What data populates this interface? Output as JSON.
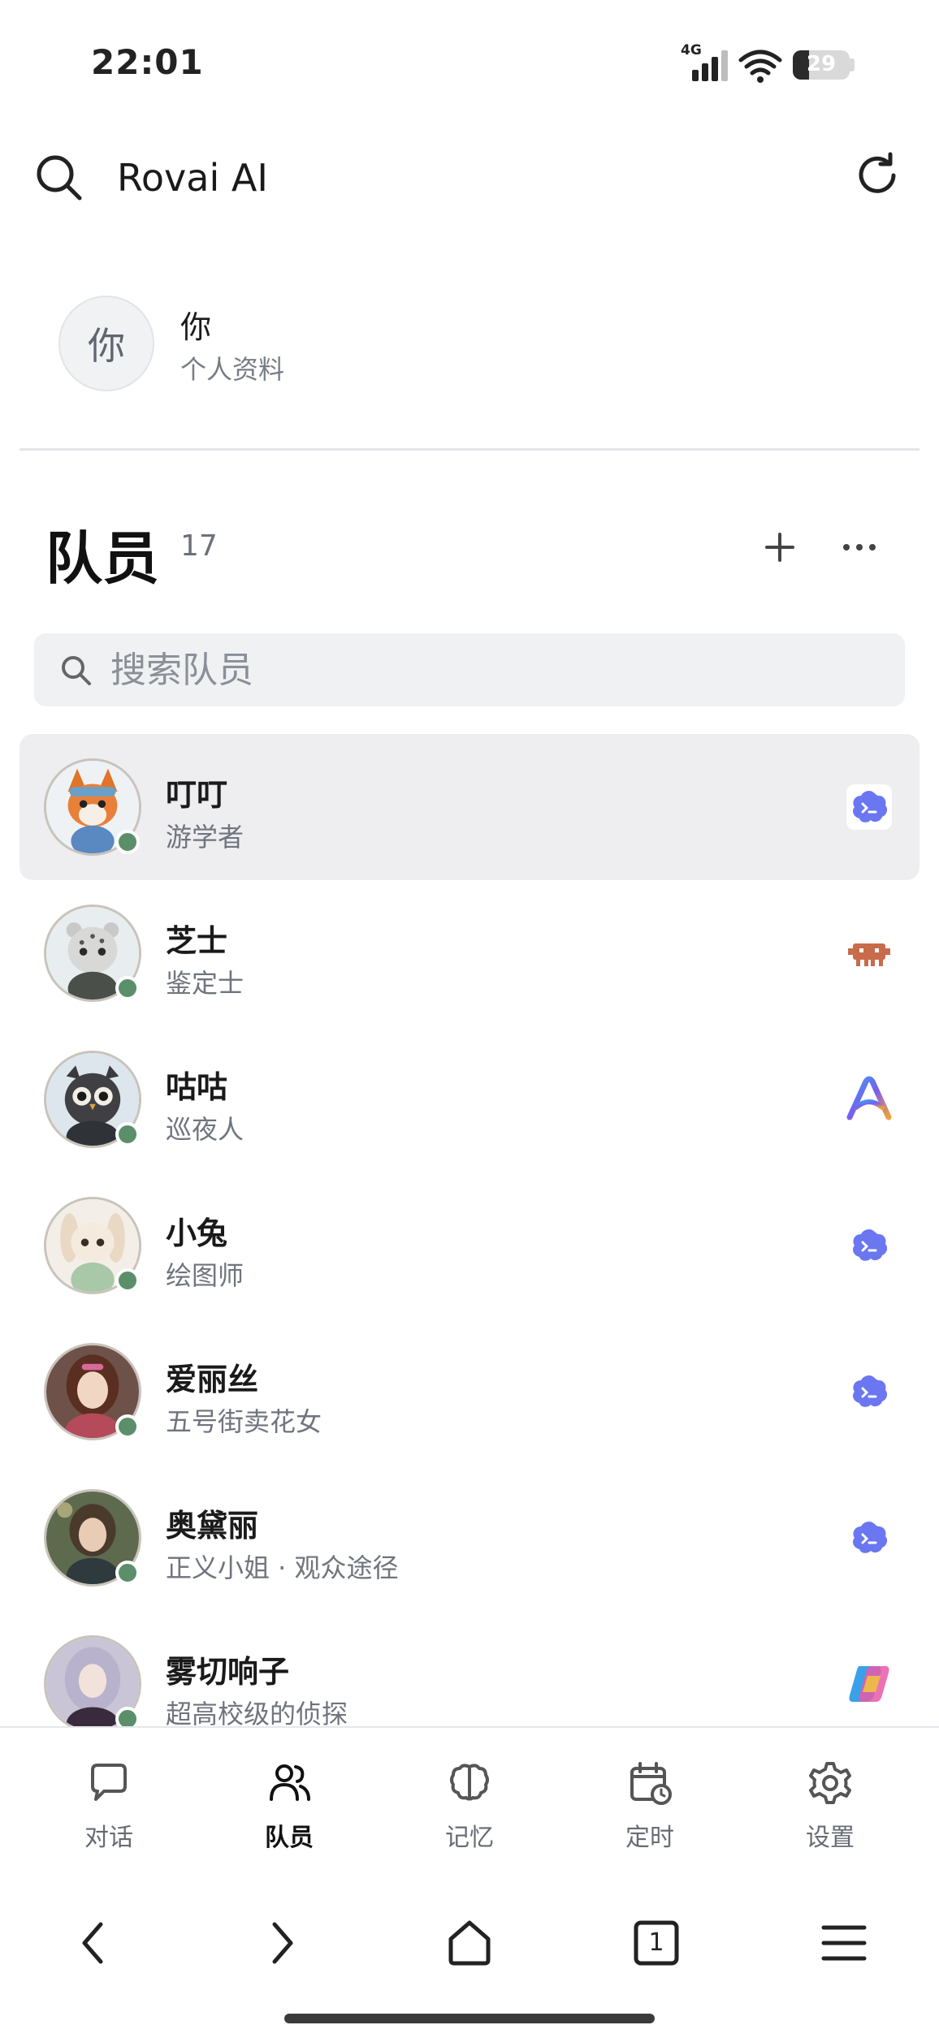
{
  "status_bar": {
    "time": "22:01",
    "network": "4G",
    "battery": "29",
    "battery_level": 0.29
  },
  "app_bar": {
    "title": "Rovai AI"
  },
  "profile": {
    "avatar_text": "你",
    "name": "你",
    "subtitle": "个人资料"
  },
  "team": {
    "title": "队员",
    "count": "17",
    "search_placeholder": "搜索队员",
    "members": [
      {
        "name": "叮叮",
        "role": "游学者",
        "avatar": "fox",
        "model_icon": "claude-code-icon",
        "selected": true
      },
      {
        "name": "芝士",
        "role": "鉴定士",
        "avatar": "snow-leopard",
        "model_icon": "robot-icon"
      },
      {
        "name": "咕咕",
        "role": "巡夜人",
        "avatar": "owl",
        "model_icon": "arc-icon"
      },
      {
        "name": "小兔",
        "role": "绘图师",
        "avatar": "bunny",
        "model_icon": "claude-code-icon"
      },
      {
        "name": "爱丽丝",
        "role": "五号街卖花女",
        "avatar": "aerith",
        "model_icon": "claude-code-icon"
      },
      {
        "name": "奥黛丽",
        "role": "正义小姐 · 观众途径",
        "avatar": "audrey",
        "model_icon": "claude-code-icon"
      },
      {
        "name": "雾切响子",
        "role": "超高校级的侦探",
        "avatar": "kyoko",
        "model_icon": "copilot-icon"
      }
    ]
  },
  "tabs": [
    {
      "label": "对话",
      "icon": "chat-icon"
    },
    {
      "label": "队员",
      "icon": "people-icon",
      "active": true
    },
    {
      "label": "记忆",
      "icon": "brain-icon"
    },
    {
      "label": "定时",
      "icon": "calendar-clock-icon"
    },
    {
      "label": "设置",
      "icon": "gear-icon"
    }
  ],
  "system_nav": {
    "tab_count": "1"
  }
}
